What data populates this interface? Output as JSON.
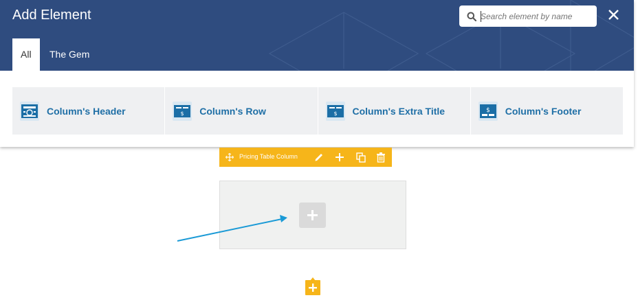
{
  "modal": {
    "title": "Add Element",
    "search": {
      "placeholder": "Search element by name",
      "value": ""
    },
    "close_icon": "close-icon",
    "tabs": [
      {
        "label": "All",
        "active": true
      },
      {
        "label": "The Gem",
        "active": false
      }
    ]
  },
  "elements": [
    {
      "label": "Column's Header",
      "icon": "pricing-header-icon"
    },
    {
      "label": "Column's Row",
      "icon": "pricing-row-icon"
    },
    {
      "label": "Column's Extra Title",
      "icon": "pricing-extra-title-icon"
    },
    {
      "label": "Column's Footer",
      "icon": "pricing-footer-icon"
    }
  ],
  "column_toolbar": {
    "label": "Pricing Table Column",
    "icons": [
      "move-icon",
      "edit-icon",
      "add-icon",
      "clone-icon",
      "delete-icon"
    ]
  },
  "colors": {
    "header_bg": "#2f4c7f",
    "toolbar_bg": "#f6b51a",
    "element_label": "#1f6fa6",
    "element_icon": "#1b6ea6",
    "arrow": "#1a9ad6"
  }
}
